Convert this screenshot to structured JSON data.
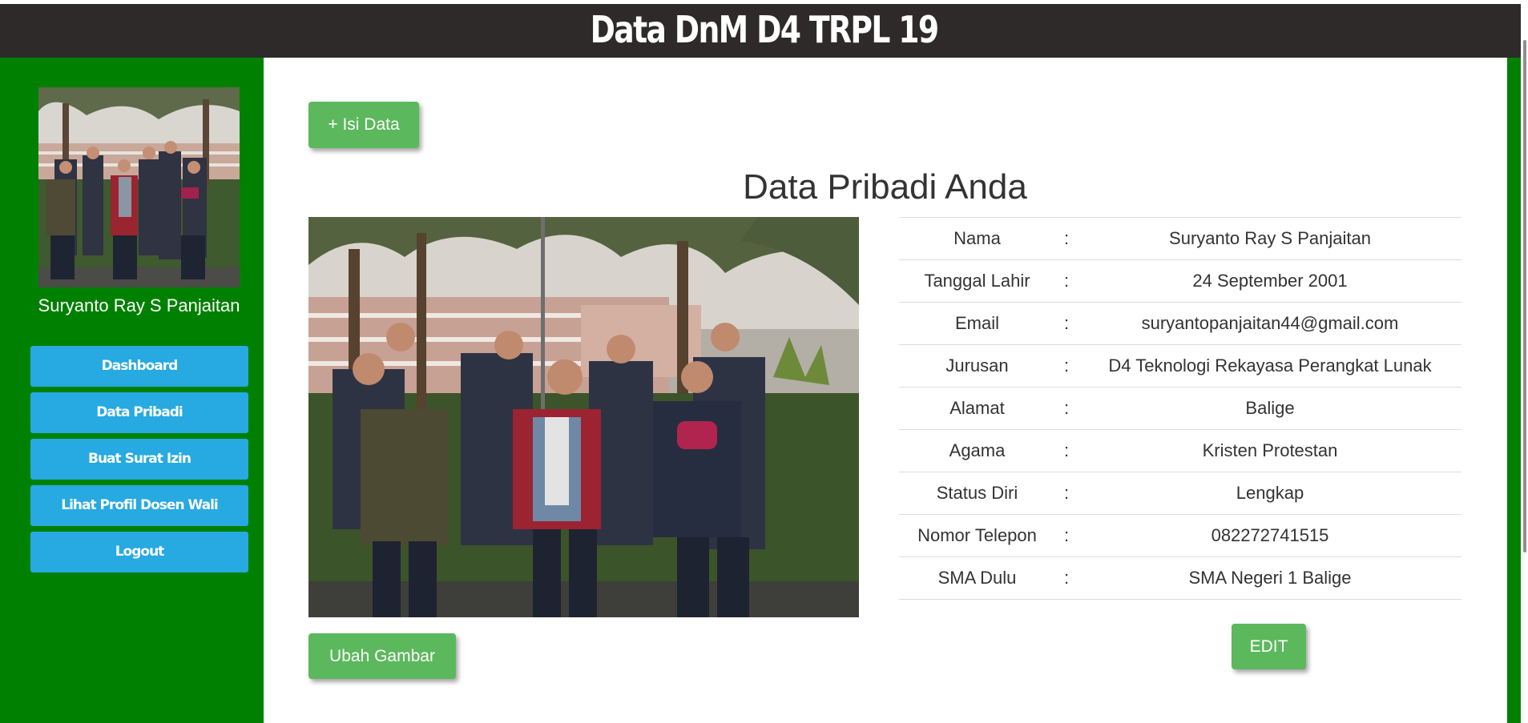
{
  "header": {
    "title": "Data DnM D4 TRPL 19"
  },
  "sidebar": {
    "user_name": "Suryanto Ray S Panjaitan",
    "menu": [
      "Dashboard",
      "Data Pribadi",
      "Buat Surat Izin",
      "Lihat Profil Dosen Wali",
      "Logout"
    ]
  },
  "main": {
    "add_button": "+ Isi Data",
    "heading": "Data Pribadi Anda",
    "change_image_button": "Ubah Gambar",
    "edit_button": "EDIT",
    "fields": [
      {
        "label": "Nama",
        "sep": ":",
        "value": "Suryanto Ray S Panjaitan"
      },
      {
        "label": "Tanggal Lahir",
        "sep": ":",
        "value": "24 September 2001"
      },
      {
        "label": "Email",
        "sep": ":",
        "value": "suryantopanjaitan44@gmail.com"
      },
      {
        "label": "Jurusan",
        "sep": ":",
        "value": "D4 Teknologi Rekayasa Perangkat Lunak"
      },
      {
        "label": "Alamat",
        "sep": ":",
        "value": "Balige"
      },
      {
        "label": "Agama",
        "sep": ":",
        "value": "Kristen Protestan"
      },
      {
        "label": "Status Diri",
        "sep": ":",
        "value": "Lengkap"
      },
      {
        "label": "Nomor Telepon",
        "sep": ":",
        "value": "082272741515"
      },
      {
        "label": "SMA Dulu",
        "sep": ":",
        "value": "SMA Negeri 1 Balige"
      }
    ]
  },
  "colors": {
    "sidebar": "#008000",
    "header": "#2d2a29",
    "menu_button": "#27a9e1",
    "action_button": "#5cb85c"
  }
}
